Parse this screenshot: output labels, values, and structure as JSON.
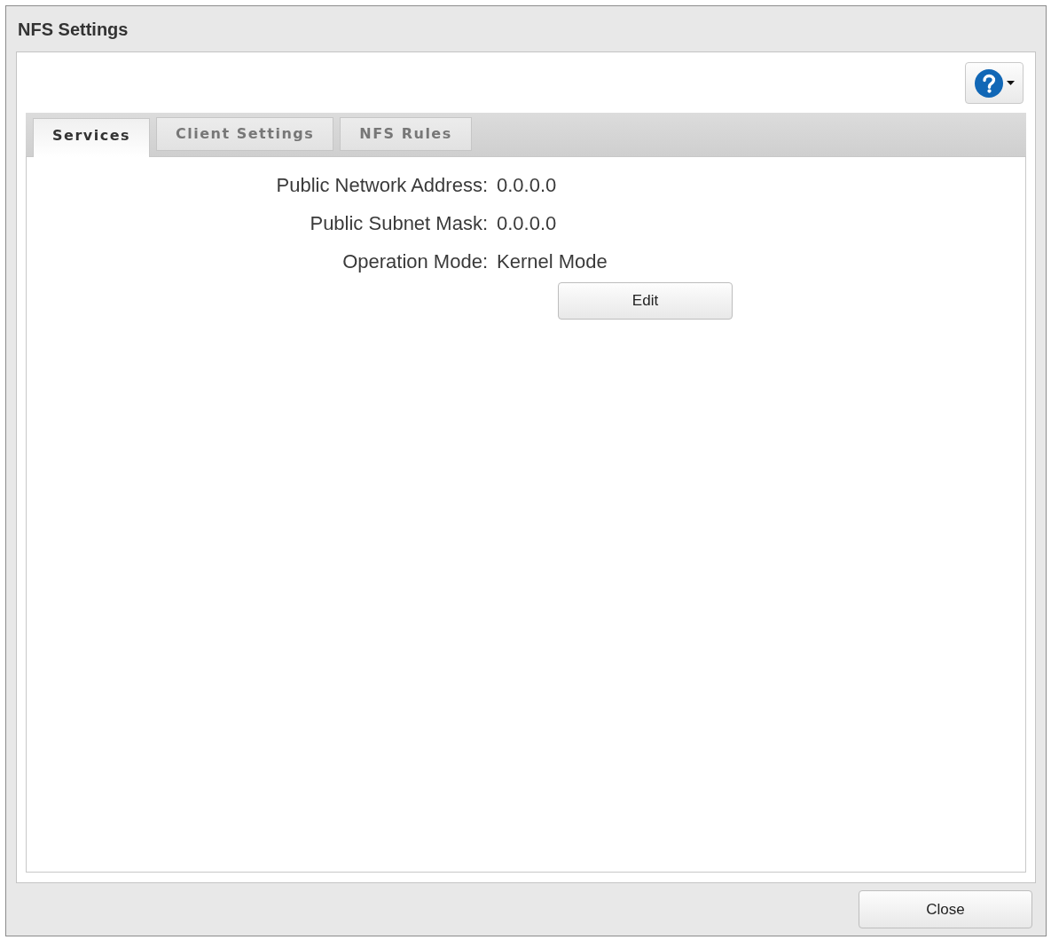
{
  "window": {
    "title": "NFS Settings"
  },
  "tabs": [
    {
      "label": "Services",
      "selected": true
    },
    {
      "label": "Client Settings",
      "selected": false
    },
    {
      "label": "NFS Rules",
      "selected": false
    }
  ],
  "fields": [
    {
      "label": "Public Network Address:",
      "value": "0.0.0.0"
    },
    {
      "label": "Public Subnet Mask:",
      "value": "0.0.0.0"
    },
    {
      "label": "Operation Mode:",
      "value": "Kernel Mode"
    }
  ],
  "edit_button": "Edit",
  "footer": {
    "close_button": "Close"
  }
}
